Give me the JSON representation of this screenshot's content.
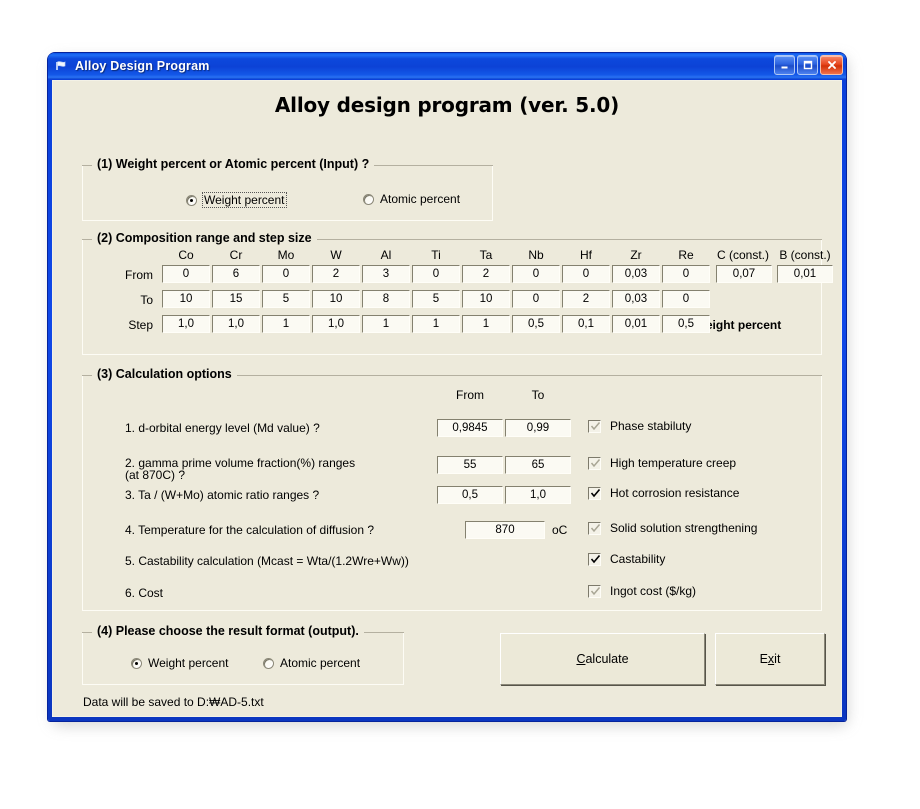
{
  "window": {
    "title": "Alloy Design Program",
    "icon": "flag-icon",
    "buttons": {
      "minimize": "minimize-icon",
      "maximize": "maximize-icon",
      "close": "close-icon"
    }
  },
  "headline": "Alloy design program (ver. 5.0)",
  "section1": {
    "title": "(1) Weight percent or Atomic percent (Input) ?",
    "options": [
      {
        "label": "Weight percent",
        "checked": true,
        "focused": true
      },
      {
        "label": "Atomic percent",
        "checked": false,
        "focused": false
      }
    ]
  },
  "section2": {
    "title": "(2) Composition range and step size",
    "row_labels": [
      "From",
      "To",
      "Step"
    ],
    "note": "Weight percent",
    "columns": [
      {
        "header": "Co",
        "from": "0",
        "to": "10",
        "step": "1,0"
      },
      {
        "header": "Cr",
        "from": "6",
        "to": "15",
        "step": "1,0"
      },
      {
        "header": "Mo",
        "from": "0",
        "to": "5",
        "step": "1"
      },
      {
        "header": "W",
        "from": "2",
        "to": "10",
        "step": "1,0"
      },
      {
        "header": "Al",
        "from": "3",
        "to": "8",
        "step": "1"
      },
      {
        "header": "Ti",
        "from": "0",
        "to": "5",
        "step": "1"
      },
      {
        "header": "Ta",
        "from": "2",
        "to": "10",
        "step": "1"
      },
      {
        "header": "Nb",
        "from": "0",
        "to": "0",
        "step": "0,5"
      },
      {
        "header": "Hf",
        "from": "0",
        "to": "2",
        "step": "0,1"
      },
      {
        "header": "Zr",
        "from": "0,03",
        "to": "0,03",
        "step": "0,01"
      },
      {
        "header": "Re",
        "from": "0",
        "to": "0",
        "step": "0,5"
      },
      {
        "header": "C (const.)",
        "from": "0,07",
        "to": "",
        "step": ""
      },
      {
        "header": "B (const.)",
        "from": "0,01",
        "to": "",
        "step": ""
      }
    ]
  },
  "section3": {
    "title": "(3) Calculation options",
    "col_from": "From",
    "col_to": "To",
    "unit_celsius": "oC",
    "rows": [
      {
        "label": "1. d-orbital energy level (Md value) ?",
        "from": "0,9845",
        "to": "0,99",
        "check_label": "Phase stabiluty",
        "checked": true,
        "disabled": true
      },
      {
        "label": "2. gamma prime volume fraction(%) ranges",
        "label2": "(at 870C) ?",
        "from": "55",
        "to": "65",
        "check_label": "High temperature creep",
        "checked": true,
        "disabled": true
      },
      {
        "label": "3. Ta / (W+Mo) atomic ratio ranges ?",
        "from": "0,5",
        "to": "1,0",
        "check_label": "Hot corrosion resistance",
        "checked": true,
        "disabled": false
      },
      {
        "label": "4. Temperature for the calculation of diffusion ?",
        "temp": "870",
        "check_label": "Solid solution strengthening",
        "checked": true,
        "disabled": true
      },
      {
        "label": "5. Castability calculation (Mcast = Wta/(1.2Wre+Ww))",
        "check_label": "Castability",
        "checked": true,
        "disabled": false
      },
      {
        "label": "6. Cost",
        "check_label": "Ingot cost ($/kg)",
        "checked": true,
        "disabled": true
      }
    ]
  },
  "section4": {
    "title": "(4) Please choose the result format (output).",
    "options": [
      {
        "label": "Weight percent",
        "checked": true
      },
      {
        "label": "Atomic percent",
        "checked": false
      }
    ]
  },
  "actions": {
    "calculate": {
      "pre": "C",
      "post": "alculate"
    },
    "exit": {
      "pre": "E",
      "acc": "x",
      "post": "it"
    }
  },
  "footnote": "Data will be saved to D:₩AD-5.txt",
  "colors": {
    "titlebar_blue": "#0c42d6",
    "client_bg": "#edeadb",
    "field_bg": "#fbfaf3",
    "close_red": "#e84a22"
  }
}
